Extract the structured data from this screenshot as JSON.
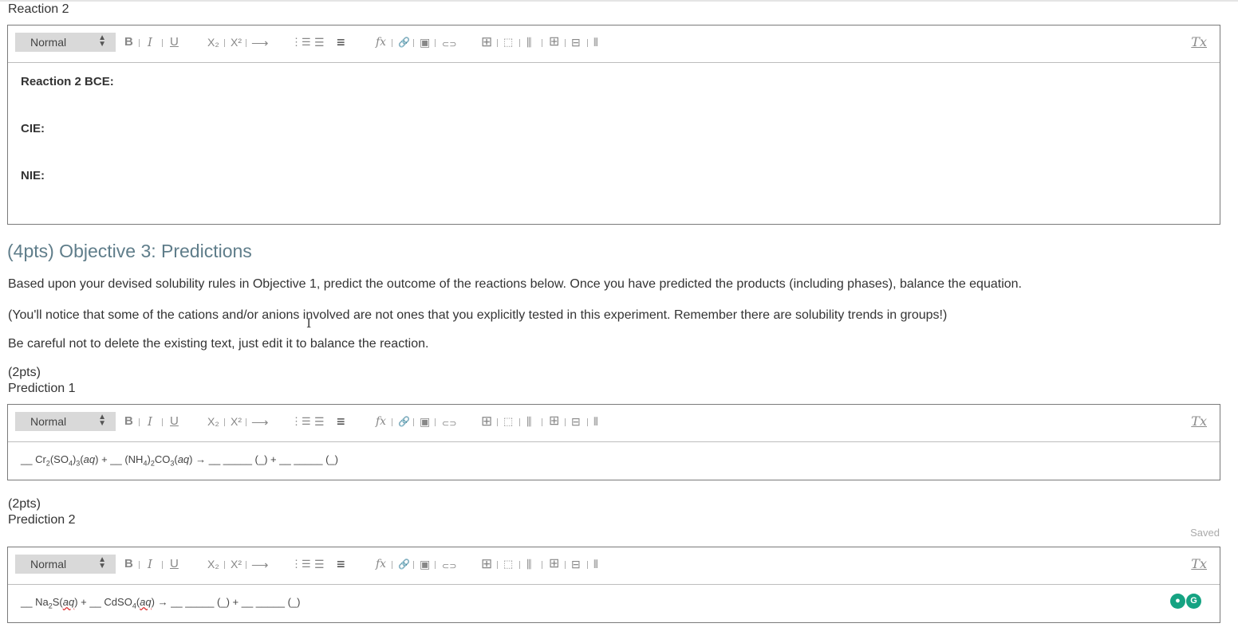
{
  "reaction2": {
    "label": "Reaction 2",
    "lines": [
      "Reaction 2 BCE:",
      "CIE:",
      "NIE:"
    ]
  },
  "toolbar": {
    "format_value": "Normal",
    "buttons": [
      {
        "name": "bold-button",
        "glyph": "B"
      },
      {
        "name": "italic-button",
        "glyph": "I"
      },
      {
        "name": "underline-button",
        "glyph": "U"
      },
      {
        "name": "subscript-button",
        "glyph": "X₂"
      },
      {
        "name": "superscript-button",
        "glyph": "X²"
      },
      {
        "name": "arrow-button",
        "glyph": "⟶"
      },
      {
        "name": "ordered-list-button",
        "glyph": "⋮☰"
      },
      {
        "name": "bullet-list-button",
        "glyph": "☰"
      },
      {
        "name": "align-button",
        "glyph": "≡"
      },
      {
        "name": "formula-button",
        "glyph": "fx"
      },
      {
        "name": "link-button",
        "glyph": "🔗"
      },
      {
        "name": "image-button",
        "glyph": "▣"
      },
      {
        "name": "attach-button",
        "glyph": "⊂⊃"
      },
      {
        "name": "table-button",
        "glyph": "⊞"
      },
      {
        "name": "insert-row-button",
        "glyph": "⬚"
      },
      {
        "name": "insert-col-button",
        "glyph": "⫼"
      },
      {
        "name": "table-props-button",
        "glyph": "⊞"
      },
      {
        "name": "delete-row-button",
        "glyph": "⊟"
      },
      {
        "name": "delete-col-button",
        "glyph": "⫴"
      }
    ],
    "clear_format": "Tx"
  },
  "objective": {
    "heading": "(4pts) Objective 3: Predictions",
    "p1": "Based upon your devised solubility rules in Objective 1, predict the outcome of the reactions below. Once you have predicted the products (including phases), balance the equation.",
    "p2": "(You'll notice that some of the cations and/or anions involved are not ones that you explicitly tested in this experiment. Remember there are solubility trends in groups!)",
    "p3": "Be careful not to delete the existing text, just edit it to balance the reaction."
  },
  "prediction1": {
    "points": "(2pts)",
    "label": "Prediction 1"
  },
  "prediction2": {
    "points": "(2pts)",
    "label": "Prediction 2",
    "status": "Saved"
  },
  "grammarly": {
    "g1": "●",
    "g2": "G"
  }
}
